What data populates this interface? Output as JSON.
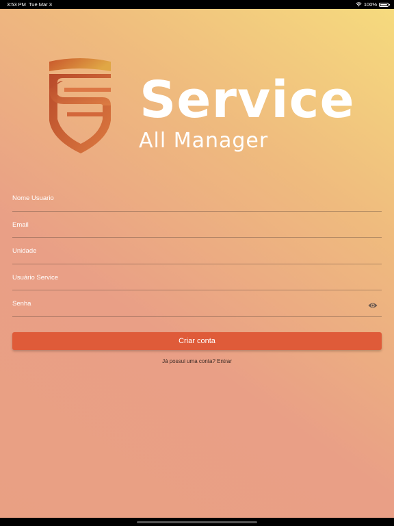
{
  "status_bar": {
    "time": "3:53 PM",
    "date": "Tue Mar 3",
    "battery": "100%",
    "wifi_icon": "wifi-icon",
    "battery_icon": "battery-icon"
  },
  "brand": {
    "title": "Service",
    "subtitle": "All Manager",
    "logo_icon": "shield-s-logo"
  },
  "form": {
    "fields": [
      {
        "placeholder": "Nome Usuario",
        "value": ""
      },
      {
        "placeholder": "Email",
        "value": ""
      },
      {
        "placeholder": "Unidade",
        "value": ""
      },
      {
        "placeholder": "Usuário Service",
        "value": ""
      },
      {
        "placeholder": "Senha",
        "value": ""
      }
    ],
    "password_toggle_icon": "eye-icon",
    "submit_label": "Criar conta",
    "login_prompt": "Já possui uma conta?",
    "login_action": "Entrar"
  },
  "colors": {
    "accent": "#df5b39",
    "gradient_top": "#f6dc7e",
    "gradient_bottom": "#e99f86",
    "logo_dark": "#c9562b",
    "logo_light": "#e3a34a"
  }
}
